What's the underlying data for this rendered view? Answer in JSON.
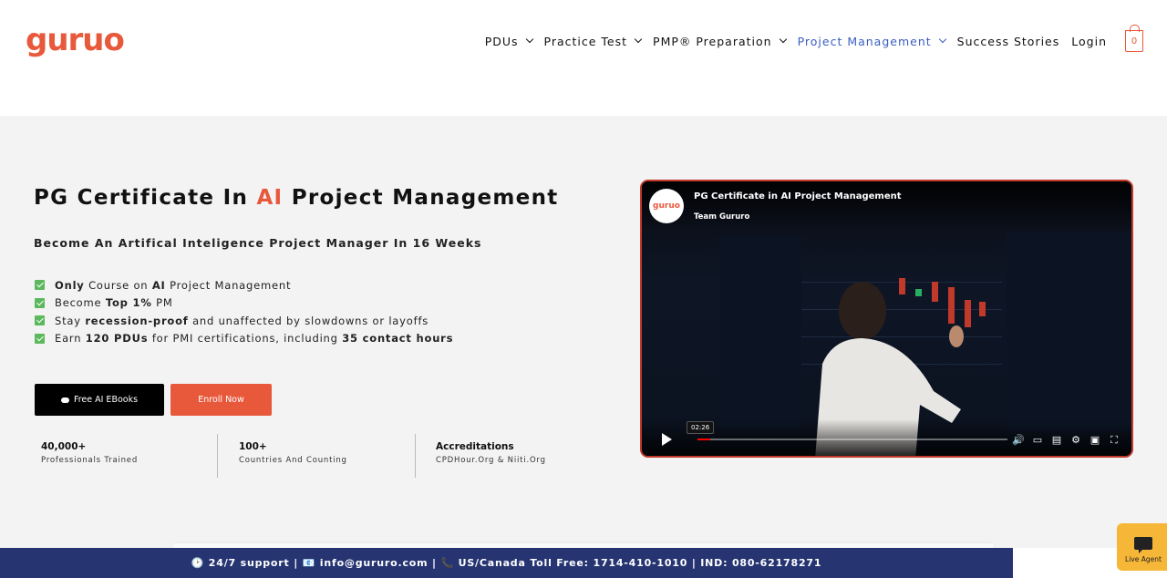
{
  "header": {
    "logo_text": "guruo",
    "nav": [
      {
        "label": "PDUs",
        "has_dropdown": true,
        "active": false
      },
      {
        "label": "Practice Test",
        "has_dropdown": true,
        "active": false
      },
      {
        "label": "PMP® Preparation",
        "has_dropdown": true,
        "active": false
      },
      {
        "label": "Project Management",
        "has_dropdown": true,
        "active": true
      },
      {
        "label": "Success Stories",
        "has_dropdown": false,
        "active": false
      },
      {
        "label": "Login",
        "has_dropdown": false,
        "active": false
      }
    ],
    "cart_count": "0"
  },
  "hero": {
    "title_pre": "PG Certificate In ",
    "title_ai": "AI",
    "title_post": " Project Management",
    "subtitle": "Become An Artifical Inteligence Project Manager In 16 Weeks",
    "features": [
      {
        "parts": [
          {
            "b": "Only"
          },
          {
            "t": " Course on "
          },
          {
            "b": "AI"
          },
          {
            "t": " Project Management"
          }
        ]
      },
      {
        "parts": [
          {
            "t": "Become "
          },
          {
            "b": "Top 1%"
          },
          {
            "t": " PM"
          }
        ]
      },
      {
        "parts": [
          {
            "t": "Stay "
          },
          {
            "b": "recession-proof"
          },
          {
            "t": " and unaffected by slowdowns or layoffs"
          }
        ]
      },
      {
        "parts": [
          {
            "t": "Earn "
          },
          {
            "b": "120 PDUs"
          },
          {
            "t": " for PMI certifications, including "
          },
          {
            "b": "35 contact hours"
          }
        ]
      }
    ],
    "btn_ebooks": "Free AI EBooks",
    "btn_enroll": "Enroll Now",
    "stats": [
      {
        "num": "40,000+",
        "label": "Professionals Trained"
      },
      {
        "num": "100+",
        "label": "Countries And Counting"
      },
      {
        "num": "Accreditations",
        "label": "CPDHour.Org & Niiti.Org"
      }
    ]
  },
  "video": {
    "title": "PG Certificate in AI Project Management",
    "channel": "Team Gururo",
    "avatar_text": "guruo",
    "time": "02:26",
    "progress": 0.04
  },
  "bottom_bar": {
    "text": "🕑 24/7 support | 📧 info@gururo.com | 📞 US/Canada Toll Free: 1714-410-1010 | IND: 080-62178271"
  },
  "live_agent": {
    "label": "Live Agent"
  },
  "colors": {
    "brand": "#e8593c",
    "nav_active": "#3b5ec2",
    "bar": "#263472",
    "check": "#5cb85c"
  }
}
